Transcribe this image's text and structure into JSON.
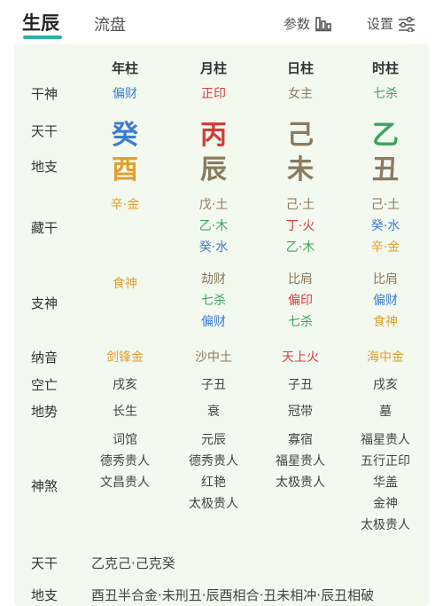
{
  "tabs": {
    "active": "生辰",
    "inactive": "流盘"
  },
  "top_buttons": {
    "params": "参数",
    "settings": "设置"
  },
  "columns": [
    "年柱",
    "月柱",
    "日柱",
    "时柱"
  ],
  "row_labels": {
    "shishen": "干神",
    "tiangan": "天干",
    "dizhi": "地支",
    "canggan": "藏干",
    "zhishen": "支神",
    "nayin": "纳音",
    "kongwang": "空亡",
    "dishi": "地势",
    "shensha": "神煞"
  },
  "shishen": [
    "偏财",
    "正印",
    "女主",
    "七杀"
  ],
  "tiangan": [
    "癸",
    "丙",
    "己",
    "乙"
  ],
  "dizhi": [
    "酉",
    "辰",
    "未",
    "丑"
  ],
  "canggan": [
    [
      "辛·金"
    ],
    [
      "戊·土",
      "乙·木",
      "癸·水"
    ],
    [
      "己·土",
      "丁·火",
      "乙·木"
    ],
    [
      "己·土",
      "癸·水",
      "辛·金"
    ]
  ],
  "zhishen": [
    [
      "食神"
    ],
    [
      "劫财",
      "七杀",
      "偏财"
    ],
    [
      "比肩",
      "偏印",
      "七杀"
    ],
    [
      "比肩",
      "偏财",
      "食神"
    ]
  ],
  "nayin": [
    "剑锋金",
    "沙中土",
    "天上火",
    "海中金"
  ],
  "kongwang": [
    "戌亥",
    "子丑",
    "子丑",
    "戌亥"
  ],
  "dishi": [
    "长生",
    "衰",
    "冠带",
    "墓"
  ],
  "shensha": [
    [
      "词馆",
      "德秀贵人",
      "文昌贵人"
    ],
    [
      "元辰",
      "德秀贵人",
      "红艳",
      "太极贵人"
    ],
    [
      "寡宿",
      "福星贵人",
      "太极贵人"
    ],
    [
      "福星贵人",
      "五行正印",
      "华盖",
      "金神",
      "太极贵人"
    ]
  ],
  "bottom": {
    "tiangan_label": "天干",
    "tiangan_text": "乙克己·己克癸",
    "dizhi_label": "地支",
    "dizhi_text": "酉丑半合金·未刑丑·辰酉相合·丑未相冲·辰丑相破"
  },
  "colors": {
    "accent": "#2db1a6",
    "water": "#3a7bd5",
    "fire": "#d93a3a",
    "earth": "#8a7a5e",
    "wood": "#3aa35f",
    "metal": "#e0a030",
    "bg": "#f4f9ef"
  }
}
